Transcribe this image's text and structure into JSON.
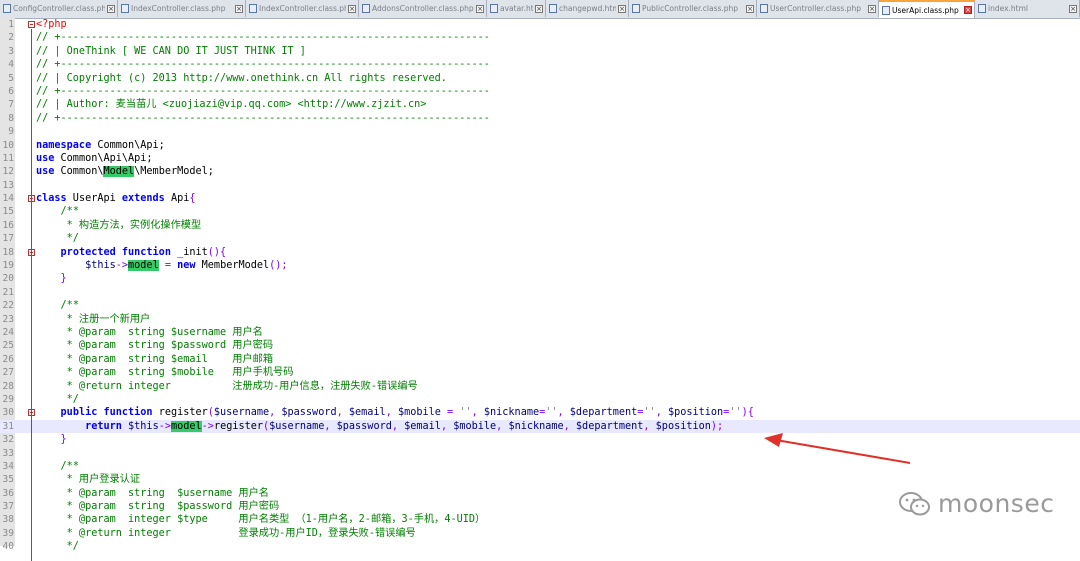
{
  "tabs": [
    {
      "label": "ConfigController.class.php",
      "width": 118,
      "active": false
    },
    {
      "label": "IndexController.class.php",
      "width": 128,
      "active": false
    },
    {
      "label": "IndexController.class.php",
      "width": 113,
      "active": false
    },
    {
      "label": "AddonsController.class.php",
      "width": 128,
      "active": false
    },
    {
      "label": "avatar.html",
      "width": 59,
      "active": false
    },
    {
      "label": "changepwd.html",
      "width": 83,
      "active": false
    },
    {
      "label": "PublicController.class.php",
      "width": 128,
      "active": false
    },
    {
      "label": "UserController.class.php",
      "width": 122,
      "active": false
    },
    {
      "label": "UserApi.class.php",
      "width": 96,
      "active": true
    },
    {
      "label": "index.html",
      "width": 105,
      "active": false
    }
  ],
  "code_lines": [
    {
      "n": "1",
      "fold": true,
      "html": "<span class=\"tag\">&lt;?php</span>"
    },
    {
      "n": "2",
      "html": "<span class=\"cm\">// +----------------------------------------------------------------------</span>"
    },
    {
      "n": "3",
      "html": "<span class=\"cm\">// | OneThink [ WE CAN DO IT JUST THINK IT ]</span>"
    },
    {
      "n": "4",
      "html": "<span class=\"cm\">// +----------------------------------------------------------------------</span>"
    },
    {
      "n": "5",
      "html": "<span class=\"cm\">// | Copyright (c) 2013 http://www.onethink.cn All rights reserved.</span>"
    },
    {
      "n": "6",
      "html": "<span class=\"cm\">// +----------------------------------------------------------------------</span>"
    },
    {
      "n": "7",
      "html": "<span class=\"cm\">// | Author: 麦当苗儿 &lt;zuojiazi@vip.qq.com&gt; &lt;http://www.zjzit.cn&gt;</span>"
    },
    {
      "n": "8",
      "html": "<span class=\"cm\">// +----------------------------------------------------------------------</span>"
    },
    {
      "n": "9",
      "html": ""
    },
    {
      "n": "10",
      "html": "<span class=\"kw\">namespace</span> Common\\Api;"
    },
    {
      "n": "11",
      "html": "<span class=\"kw\">use</span> Common\\Api\\Api;"
    },
    {
      "n": "12",
      "html": "<span class=\"kw\">use</span> Common\\<span class=\"hl\">Model</span>\\MemberModel;"
    },
    {
      "n": "13",
      "html": ""
    },
    {
      "n": "14",
      "fold": true,
      "html": "<span class=\"kw\">class</span> UserApi <span class=\"kw\">extends</span> Api<span class=\"op\">{</span>"
    },
    {
      "n": "15",
      "html": "    <span class=\"cm\">/**</span>"
    },
    {
      "n": "16",
      "html": "<span class=\"cm\">     * 构造方法，实例化操作模型</span>"
    },
    {
      "n": "17",
      "html": "<span class=\"cm\">     */</span>"
    },
    {
      "n": "18",
      "fold": true,
      "html": "    <span class=\"kw\">protected function</span> _init<span class=\"op\">(){</span>"
    },
    {
      "n": "19",
      "html": "        <span class=\"var\">$this</span><span class=\"op\">-&gt;</span><span class=\"hl\">model</span> <span class=\"op\">=</span> <span class=\"kw\">new</span> MemberModel<span class=\"op\">();</span>"
    },
    {
      "n": "20",
      "html": "    <span class=\"op\">}</span>"
    },
    {
      "n": "21",
      "html": ""
    },
    {
      "n": "22",
      "html": "    <span class=\"cm\">/**</span>"
    },
    {
      "n": "23",
      "html": "<span class=\"cm\">     * 注册一个新用户</span>"
    },
    {
      "n": "24",
      "html": "<span class=\"cm\">     * @param  string $username 用户名</span>"
    },
    {
      "n": "25",
      "html": "<span class=\"cm\">     * @param  string $password 用户密码</span>"
    },
    {
      "n": "26",
      "html": "<span class=\"cm\">     * @param  string $email    用户邮箱</span>"
    },
    {
      "n": "27",
      "html": "<span class=\"cm\">     * @param  string $mobile   用户手机号码</span>"
    },
    {
      "n": "28",
      "html": "<span class=\"cm\">     * @return integer          注册成功-用户信息，注册失败-错误编号</span>"
    },
    {
      "n": "29",
      "html": "<span class=\"cm\">     */</span>"
    },
    {
      "n": "30",
      "fold": true,
      "html": "    <span class=\"kw\">public function</span> register<span class=\"op\">(</span><span class=\"var\">$username</span><span class=\"op\">,</span> <span class=\"var\">$password</span><span class=\"op\">,</span> <span class=\"var\">$email</span><span class=\"op\">,</span> <span class=\"var\">$mobile</span> <span class=\"op\">=</span> <span class=\"st\">''</span><span class=\"op\">,</span> <span class=\"var\">$nickname</span><span class=\"op\">=</span><span class=\"st\">''</span><span class=\"op\">,</span> <span class=\"var\">$department</span><span class=\"op\">=</span><span class=\"st\">''</span><span class=\"op\">,</span> <span class=\"var\">$position</span><span class=\"op\">=</span><span class=\"st\">''</span><span class=\"op\">){</span>"
    },
    {
      "n": "31",
      "current": true,
      "html": "        <span class=\"kw\">return</span> <span class=\"var\">$this</span><span class=\"op\">-&gt;</span><span class=\"hl\">model</span><span class=\"op\">-&gt;</span>register<span class=\"op\">(</span><span class=\"var\">$username</span><span class=\"op\">,</span> <span class=\"var\">$password</span><span class=\"op\">,</span> <span class=\"var\">$email</span><span class=\"op\">,</span> <span class=\"var\">$mobile</span><span class=\"op\">,</span> <span class=\"var\">$nickname</span><span class=\"op\">,</span> <span class=\"var\">$department</span><span class=\"op\">,</span> <span class=\"var\">$position</span><span class=\"op\">);</span>"
    },
    {
      "n": "32",
      "html": "    <span class=\"op\">}</span>"
    },
    {
      "n": "33",
      "html": ""
    },
    {
      "n": "34",
      "html": "    <span class=\"cm\">/**</span>"
    },
    {
      "n": "35",
      "html": "<span class=\"cm\">     * 用户登录认证</span>"
    },
    {
      "n": "36",
      "html": "<span class=\"cm\">     * @param  string  $username 用户名</span>"
    },
    {
      "n": "37",
      "html": "<span class=\"cm\">     * @param  string  $password 用户密码</span>"
    },
    {
      "n": "38",
      "html": "<span class=\"cm\">     * @param  integer $type     用户名类型 （1-用户名，2-邮箱，3-手机，4-UID）</span>"
    },
    {
      "n": "39",
      "html": "<span class=\"cm\">     * @return integer           登录成功-用户ID，登录失败-错误编号</span>"
    },
    {
      "n": "40",
      "html": "<span class=\"cm\">     */</span>"
    }
  ],
  "watermark": {
    "text": "moonsec"
  },
  "colors": {
    "accent_arrow": "#e0312a",
    "match_highlight": "#33cc66",
    "current_line": "#e8e8ff"
  }
}
